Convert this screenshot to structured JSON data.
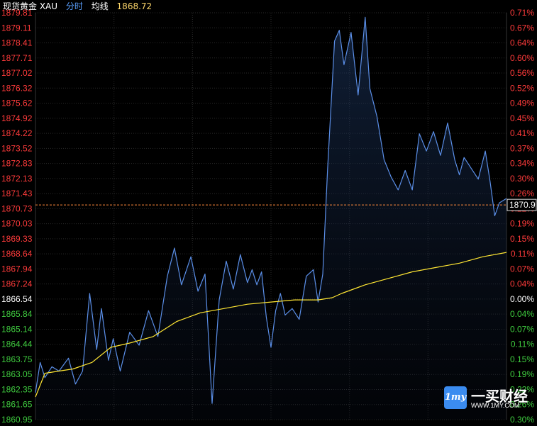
{
  "header": {
    "title": "现货黄金 XAU",
    "mode": "分时",
    "avg_label": "均线",
    "avg_value": "1868.72"
  },
  "colors": {
    "up": "#ff3b3b",
    "down": "#3fcb3f",
    "zero": "#ffffff",
    "price_line": "#5b8fe8",
    "avg_line": "#ffe633",
    "ref_line": "#ff8a3c",
    "grid": "#2a2a2a"
  },
  "logo": {
    "name": "一买财经",
    "url": "WWW.1MY.COM",
    "badge": "1my"
  },
  "chart_data": {
    "type": "line",
    "x_range": [
      0,
      1
    ],
    "ylim": [
      1860.95,
      1879.81
    ],
    "ref_price": 1866.54,
    "last_price": "1870.9",
    "left_ticks": [
      "1879.81",
      "1879.11",
      "1878.41",
      "1877.71",
      "1877.02",
      "1876.32",
      "1875.62",
      "1874.92",
      "1874.22",
      "1873.52",
      "1872.83",
      "1872.13",
      "1871.43",
      "1870.73",
      "1870.03",
      "1869.33",
      "1868.64",
      "1867.94",
      "1867.24",
      "1866.54",
      "1865.84",
      "1865.14",
      "1864.44",
      "1863.75",
      "1863.05",
      "1862.35",
      "1861.65",
      "1860.95"
    ],
    "right_ticks": [
      "0.71%",
      "0.67%",
      "0.64%",
      "0.60%",
      "0.56%",
      "0.52%",
      "0.49%",
      "0.45%",
      "0.41%",
      "0.37%",
      "0.34%",
      "0.30%",
      "0.26%",
      "0.22%",
      "0.19%",
      "0.15%",
      "0.11%",
      "0.07%",
      "0.04%",
      "0.00%",
      "0.04%",
      "0.07%",
      "0.11%",
      "0.15%",
      "0.19%",
      "0.22%",
      "0.26%",
      "0.30%"
    ],
    "series": [
      {
        "key": "price",
        "x": [
          0,
          0.01,
          0.02,
          0.035,
          0.05,
          0.07,
          0.085,
          0.1,
          0.115,
          0.13,
          0.14,
          0.155,
          0.165,
          0.18,
          0.2,
          0.22,
          0.24,
          0.26,
          0.28,
          0.295,
          0.31,
          0.33,
          0.345,
          0.36,
          0.375,
          0.39,
          0.405,
          0.42,
          0.435,
          0.45,
          0.46,
          0.47,
          0.48,
          0.49,
          0.5,
          0.51,
          0.52,
          0.53,
          0.545,
          0.56,
          0.575,
          0.59,
          0.6,
          0.61,
          0.62,
          0.635,
          0.645,
          0.655,
          0.67,
          0.685,
          0.7,
          0.71,
          0.725,
          0.74,
          0.755,
          0.77,
          0.785,
          0.8,
          0.815,
          0.83,
          0.845,
          0.86,
          0.875,
          0.89,
          0.9,
          0.91,
          0.925,
          0.94,
          0.955,
          0.965,
          0.975,
          0.985,
          1
        ],
        "y": [
          1862.2,
          1863.6,
          1862.9,
          1863.4,
          1863.2,
          1863.8,
          1862.6,
          1863.2,
          1866.8,
          1864.2,
          1866.1,
          1863.7,
          1864.7,
          1863.2,
          1865.0,
          1864.4,
          1866.0,
          1864.8,
          1867.6,
          1868.9,
          1867.2,
          1868.5,
          1866.9,
          1867.7,
          1861.7,
          1866.5,
          1868.3,
          1867.0,
          1868.6,
          1867.3,
          1867.9,
          1867.2,
          1867.8,
          1865.7,
          1864.3,
          1866.0,
          1866.8,
          1865.8,
          1866.1,
          1865.6,
          1867.6,
          1867.9,
          1866.4,
          1867.7,
          1872.5,
          1878.5,
          1879.0,
          1877.4,
          1878.9,
          1876.0,
          1879.6,
          1876.3,
          1875.0,
          1873.0,
          1872.2,
          1871.6,
          1872.5,
          1871.6,
          1874.2,
          1873.4,
          1874.3,
          1873.2,
          1874.7,
          1873.0,
          1872.3,
          1873.1,
          1872.6,
          1872.1,
          1873.4,
          1872.0,
          1870.4,
          1871.0,
          1871.2
        ]
      },
      {
        "key": "avg",
        "x": [
          0,
          0.02,
          0.05,
          0.08,
          0.12,
          0.16,
          0.2,
          0.25,
          0.3,
          0.35,
          0.4,
          0.45,
          0.5,
          0.55,
          0.6,
          0.63,
          0.65,
          0.7,
          0.75,
          0.8,
          0.85,
          0.9,
          0.95,
          1
        ],
        "y": [
          1862.0,
          1863.1,
          1863.2,
          1863.3,
          1863.6,
          1864.3,
          1864.5,
          1864.8,
          1865.5,
          1865.9,
          1866.1,
          1866.3,
          1866.4,
          1866.5,
          1866.5,
          1866.6,
          1866.8,
          1867.2,
          1867.5,
          1867.8,
          1868.0,
          1868.2,
          1868.5,
          1868.7
        ]
      }
    ]
  }
}
